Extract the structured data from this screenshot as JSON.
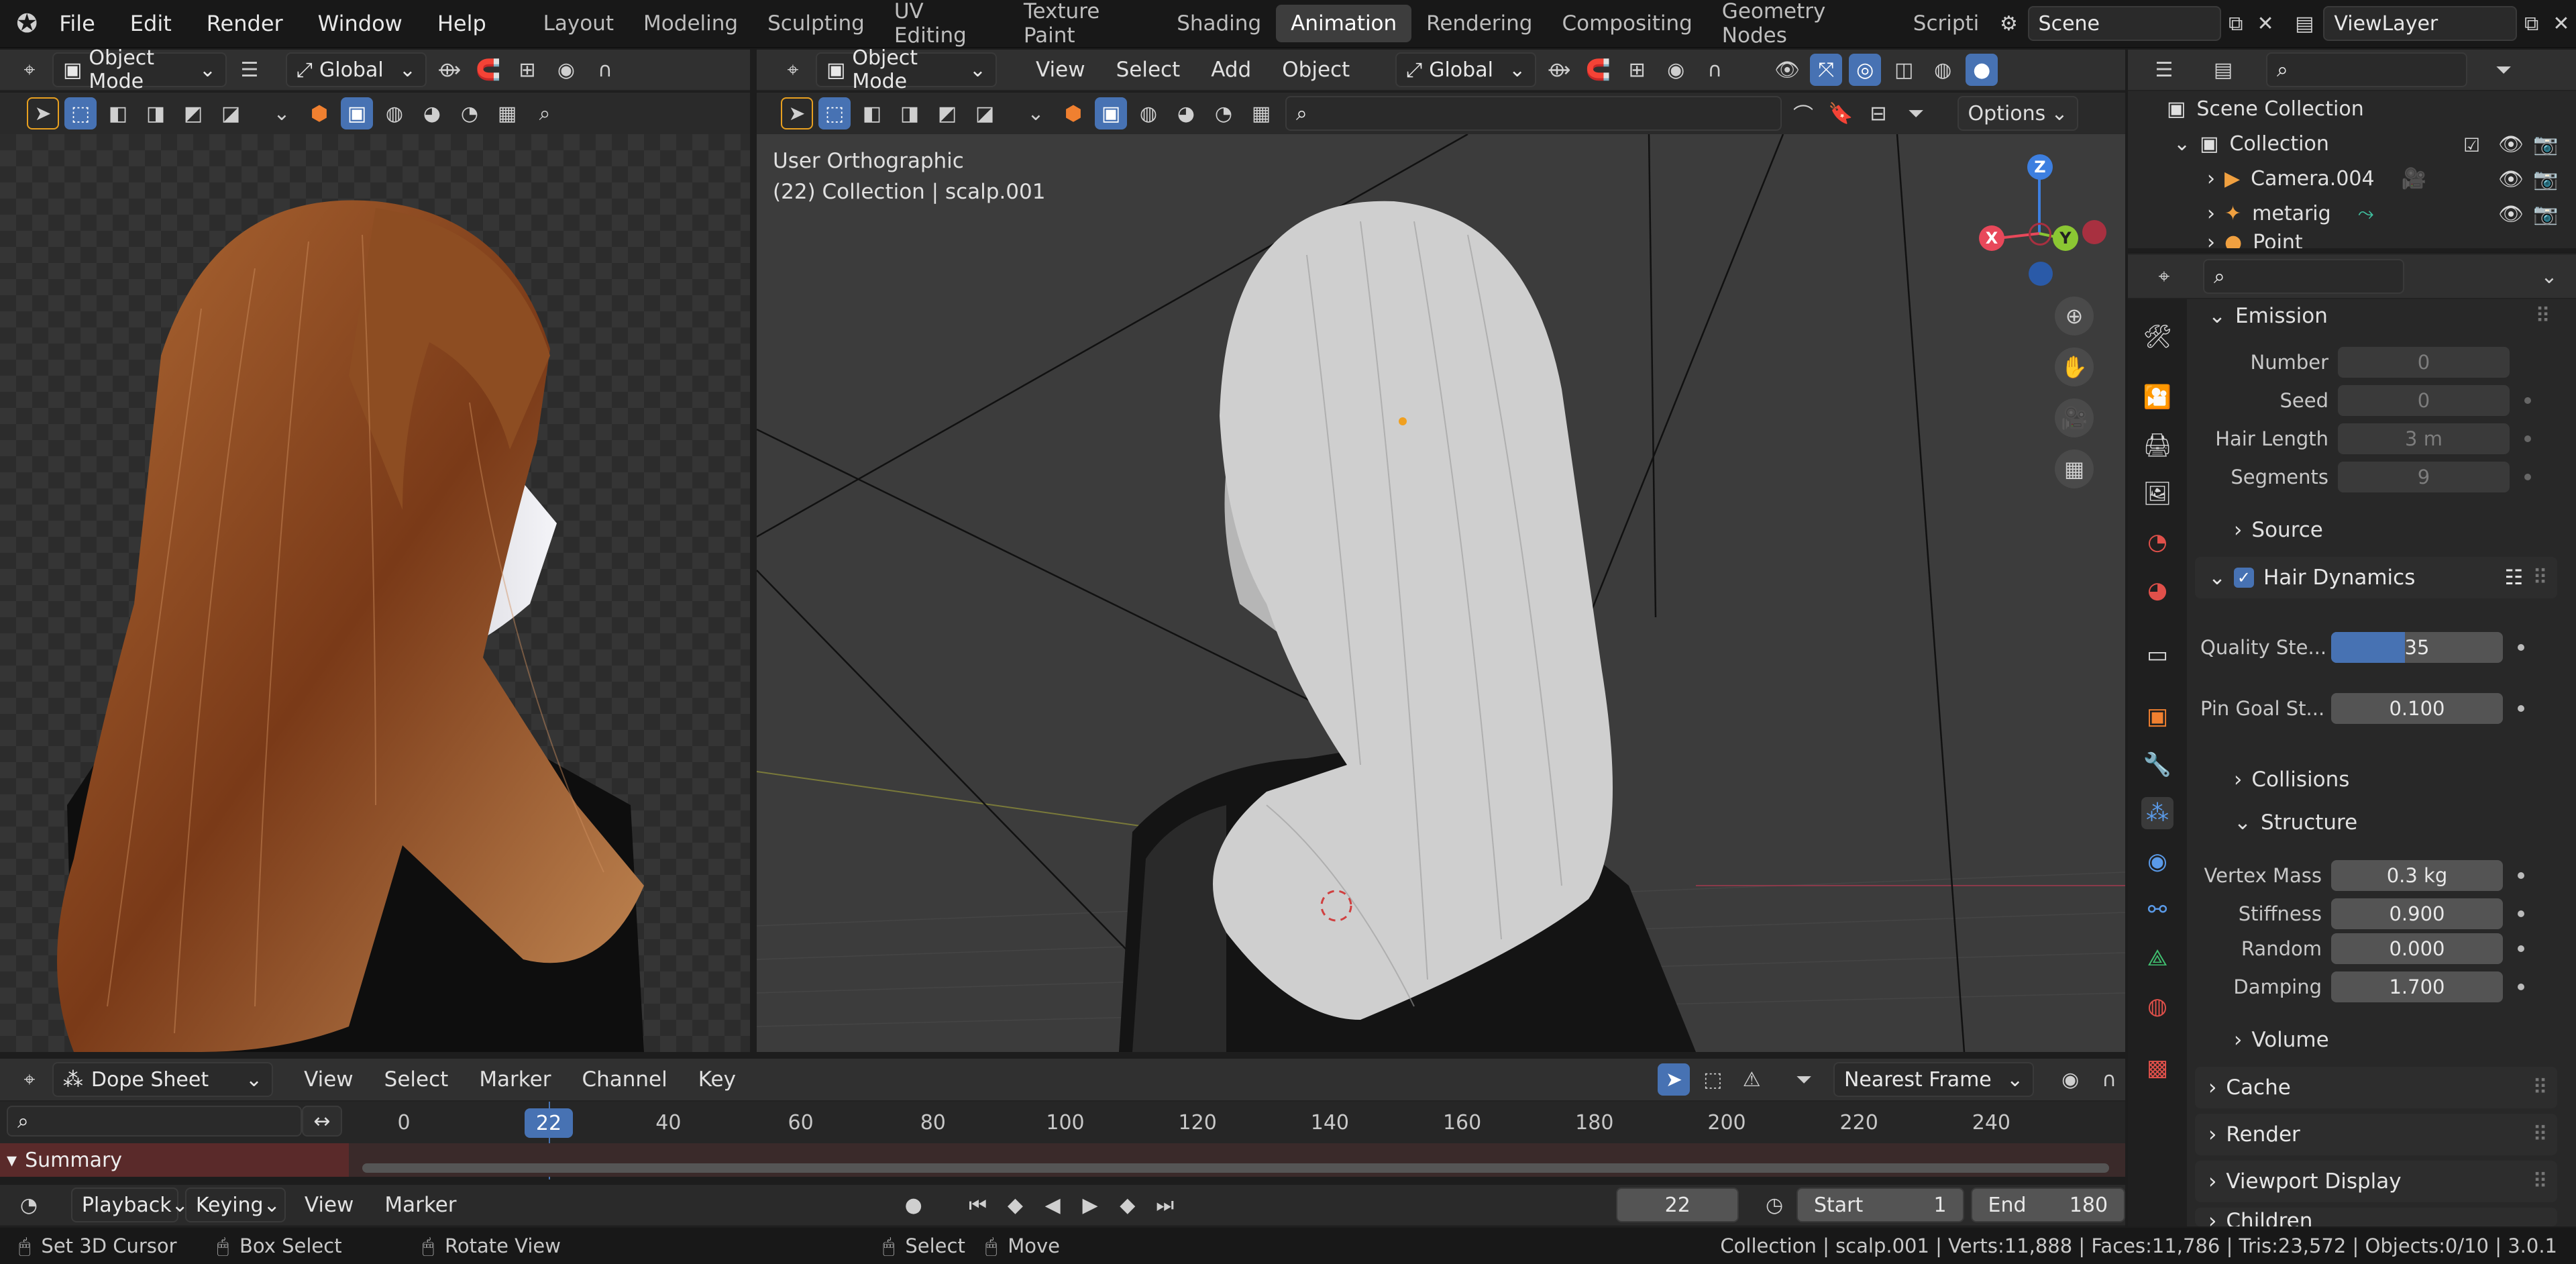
{
  "topbar": {
    "menus": [
      "File",
      "Edit",
      "Render",
      "Window",
      "Help"
    ],
    "workspaces": [
      "Layout",
      "Modeling",
      "Sculpting",
      "UV Editing",
      "Texture Paint",
      "Shading",
      "Animation",
      "Rendering",
      "Compositing",
      "Geometry Nodes",
      "Scripti"
    ],
    "active_workspace": "Animation",
    "scene": "Scene",
    "view_layer": "ViewLayer"
  },
  "left_viewport": {
    "mode": "Object Mode",
    "orientation": "Global"
  },
  "main_viewport": {
    "mode": "Object Mode",
    "menus": [
      "View",
      "Select",
      "Add",
      "Object"
    ],
    "orientation": "Global",
    "options_label": "Options",
    "overlay_line1": "User Orthographic",
    "overlay_line2": "(22) Collection | scalp.001",
    "gizmo": {
      "x": "X",
      "y": "Y",
      "z": "Z"
    }
  },
  "outliner": {
    "root": "Scene Collection",
    "collection": "Collection",
    "items": [
      "Camera.004",
      "metarig",
      "Point"
    ]
  },
  "properties": {
    "emission": {
      "title": "Emission",
      "rows": [
        {
          "label": "Number",
          "value": "0"
        },
        {
          "label": "Seed",
          "value": "0"
        },
        {
          "label": "Hair Length",
          "value": "3 m"
        },
        {
          "label": "Segments",
          "value": "9"
        }
      ]
    },
    "source_label": "Source",
    "hair_dynamics": {
      "title": "Hair Dynamics",
      "enabled": true,
      "quality_label": "Quality Ste...",
      "quality_value": "35",
      "quality_fill_fraction": 0.43,
      "pin_label": "Pin Goal St...",
      "pin_value": "0.100"
    },
    "collisions_label": "Collisions",
    "structure": {
      "title": "Structure",
      "rows": [
        {
          "label": "Vertex Mass",
          "value": "0.3 kg"
        },
        {
          "label": "Stiffness",
          "value": "0.900"
        },
        {
          "label": "Random",
          "value": "0.000"
        },
        {
          "label": "Damping",
          "value": "1.700"
        }
      ]
    },
    "volume_label": "Volume",
    "panels": [
      "Cache",
      "Render",
      "Viewport Display",
      "Children"
    ]
  },
  "dopesheet": {
    "editor": "Dope Sheet",
    "menus": [
      "View",
      "Select",
      "Marker",
      "Channel",
      "Key"
    ],
    "snap": "Nearest Frame",
    "summary": "Summary",
    "current_frame": "22",
    "ticks": [
      "0",
      "40",
      "60",
      "80",
      "100",
      "120",
      "140",
      "160",
      "180",
      "200",
      "220",
      "240"
    ]
  },
  "playback": {
    "menus": [
      "Playback",
      "Keying",
      "View",
      "Marker"
    ],
    "frame": "22",
    "start_label": "Start",
    "start": "1",
    "end_label": "End",
    "end": "180"
  },
  "statusbar": {
    "hints": [
      "Set 3D Cursor",
      "Box Select",
      "Rotate View",
      "Select",
      "Move"
    ],
    "stats": "Collection | scalp.001 | Verts:11,888 | Faces:11,786 | Tris:23,572 | Objects:0/10 | 3.0.1"
  },
  "colors": {
    "accent": "#4772b3",
    "hair_render": "#8a4a20",
    "summary_row": "#5a2a2a",
    "axis_x": "#e8485a",
    "axis_y": "#8bc733",
    "axis_z": "#3d7fe0"
  }
}
